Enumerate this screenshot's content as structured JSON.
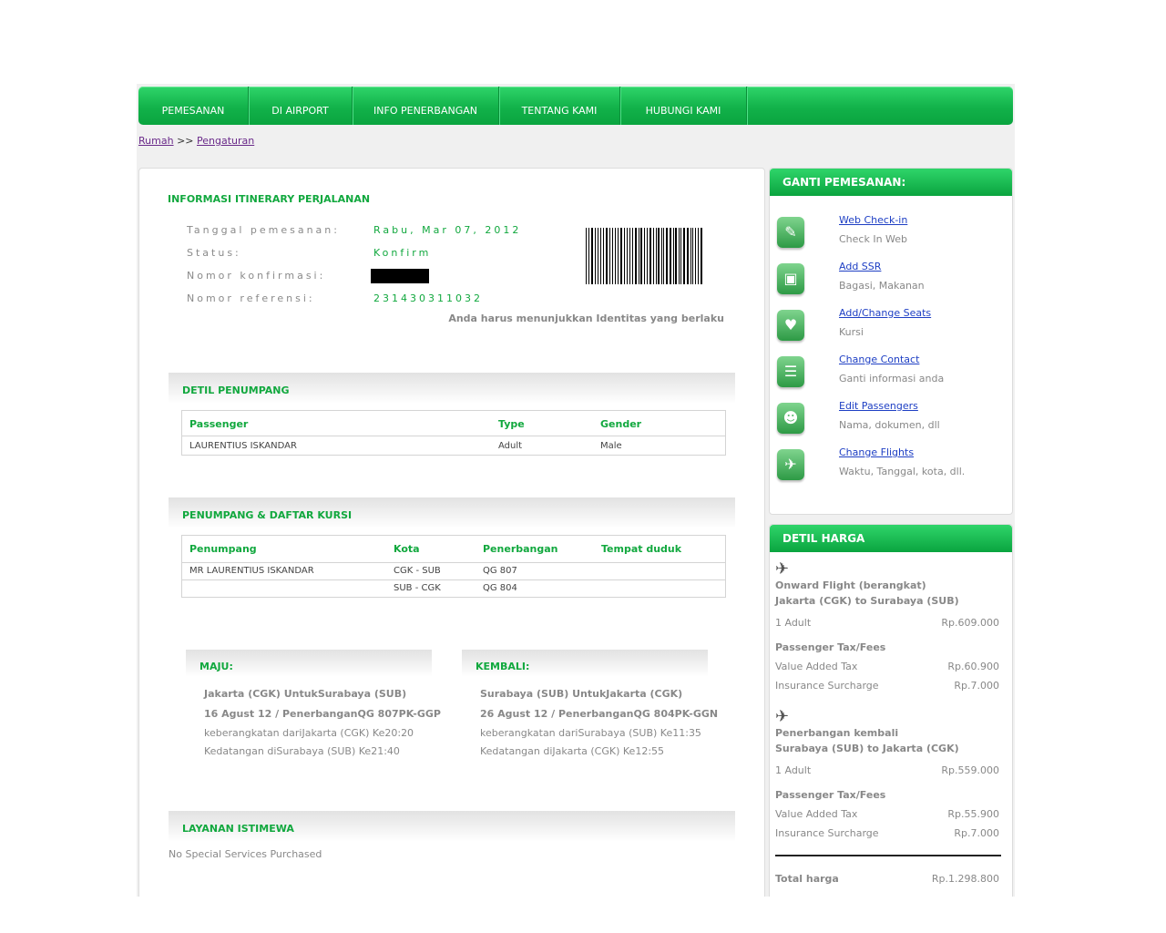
{
  "nav": {
    "items": [
      "PEMESANAN",
      "DI AIRPORT",
      "INFO PENERBANGAN",
      "TENTANG KAMI",
      "HUBUNGI KAMI"
    ]
  },
  "breadcrumb": {
    "home": "Rumah",
    "sep": ">>",
    "current": "Pengaturan"
  },
  "itinerary": {
    "title": "INFORMASI ITINERARY PERJALANAN",
    "rows": [
      {
        "label": "Tanggal pemesanan:",
        "value": "Rabu, Mar 07, 2012"
      },
      {
        "label": "Status:",
        "value": "Konfirm"
      },
      {
        "label": "Nomor konfirmasi:",
        "value": ""
      },
      {
        "label": "Nomor referensi:",
        "value": "231430311032"
      }
    ],
    "id_note": "Anda harus menunjukkan Identitas yang berlaku"
  },
  "passengers": {
    "title": "DETIL PENUMPANG",
    "headers": [
      "Passenger",
      "Type",
      "Gender"
    ],
    "rows": [
      [
        "LAURENTIUS ISKANDAR",
        "Adult",
        "Male"
      ]
    ]
  },
  "seats": {
    "title": "PENUMPANG & DAFTAR KURSI",
    "headers": [
      "Penumpang",
      "Kota",
      "Penerbangan",
      "Tempat duduk"
    ],
    "rows": [
      [
        "MR LAURENTIUS ISKANDAR",
        "CGK - SUB",
        "QG  807",
        ""
      ],
      [
        "",
        "SUB - CGK",
        "QG  804",
        ""
      ]
    ]
  },
  "trips": {
    "onward": {
      "title": "MAJU:",
      "route": "Jakarta (CGK) UntukSurabaya (SUB)",
      "flight": "16 Agust 12 / PenerbanganQG  807PK-GGP",
      "depart": "keberangkatan dariJakarta (CGK) Ke20:20",
      "arrive": "Kedatangan diSurabaya (SUB) Ke21:40"
    },
    "return": {
      "title": "KEMBALI:",
      "route": "Surabaya (SUB) UntukJakarta (CGK)",
      "flight": "26 Agust 12 / PenerbanganQG  804PK-GGN",
      "depart": "keberangkatan dariSurabaya (SUB) Ke11:35",
      "arrive": "Kedatangan diJakarta (CGK) Ke12:55"
    }
  },
  "special": {
    "title": "LAYANAN ISTIMEWA",
    "text": "No Special Services Purchased"
  },
  "change": {
    "title": "GANTI PEMESANAN:",
    "options": [
      {
        "link": "Web Check-in",
        "desc": "Check In Web",
        "icon": "checkin-icon"
      },
      {
        "link": "Add SSR",
        "desc": "Bagasi, Makanan",
        "icon": "luggage-icon"
      },
      {
        "link": "Add/Change Seats",
        "desc": "Kursi",
        "icon": "seat-icon"
      },
      {
        "link": "Change Contact",
        "desc": "Ganti informasi anda",
        "icon": "contact-icon"
      },
      {
        "link": "Edit Passengers",
        "desc": "Nama, dokumen, dll",
        "icon": "passengers-icon"
      },
      {
        "link": "Change Flights",
        "desc": "Waktu, Tanggal, kota, dll.",
        "icon": "flights-icon"
      }
    ]
  },
  "price": {
    "title": "DETIL HARGA",
    "onward": {
      "heading1": "Onward Flight (berangkat)",
      "heading2": "Jakarta (CGK) to Surabaya (SUB)",
      "adult_label": "1 Adult",
      "adult_value": "Rp.609.000",
      "tax_title": "Passenger Tax/Fees",
      "vat_label": "Value Added Tax",
      "vat_value": "Rp.60.900",
      "ins_label": "Insurance Surcharge",
      "ins_value": "Rp.7.000"
    },
    "return": {
      "heading1": "Penerbangan kembali",
      "heading2": "Surabaya (SUB) to Jakarta (CGK)",
      "adult_label": "1 Adult",
      "adult_value": "Rp.559.000",
      "tax_title": "Passenger Tax/Fees",
      "vat_label": "Value Added Tax",
      "vat_value": "Rp.55.900",
      "ins_label": "Insurance Surcharge",
      "ins_value": "Rp.7.000"
    },
    "total_label": "Total harga",
    "total_value": "Rp.1.298.800"
  },
  "colors": {
    "brand_green": "#11a83e",
    "link_blue": "#1e3fc4",
    "visited_purple": "#6a2a8a"
  }
}
